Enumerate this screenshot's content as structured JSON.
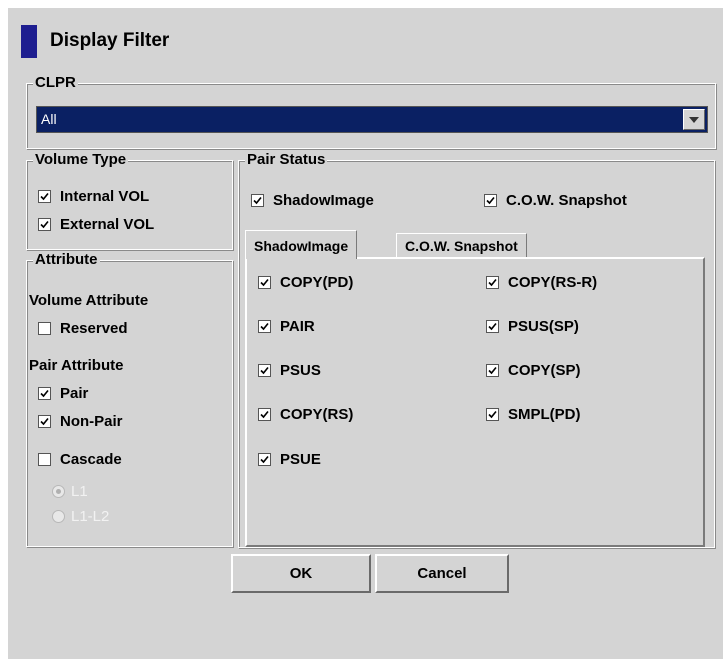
{
  "dialog": {
    "title": "Display Filter"
  },
  "clpr": {
    "legend": "CLPR",
    "selected": "All"
  },
  "volume_type": {
    "legend": "Volume Type",
    "items": [
      {
        "label": "Internal VOL",
        "checked": true
      },
      {
        "label": "External VOL",
        "checked": true
      }
    ]
  },
  "attribute": {
    "legend": "Attribute",
    "volume_attribute_label": "Volume Attribute",
    "reserved": {
      "label": "Reserved",
      "checked": false
    },
    "pair_attribute_label": "Pair Attribute",
    "pair": {
      "label": "Pair",
      "checked": true
    },
    "non_pair": {
      "label": "Non-Pair",
      "checked": true
    },
    "cascade": {
      "label": "Cascade",
      "checked": false
    },
    "levels": [
      {
        "label": "L1",
        "selected": true,
        "enabled": false
      },
      {
        "label": "L1-L2",
        "selected": false,
        "enabled": false
      }
    ]
  },
  "pair_status": {
    "legend": "Pair Status",
    "shadowimage": {
      "label": "ShadowImage",
      "checked": true
    },
    "cow": {
      "label": "C.O.W. Snapshot",
      "checked": true
    },
    "tabs": [
      {
        "label": "ShadowImage",
        "active": true
      },
      {
        "label": "C.O.W. Snapshot",
        "active": false
      }
    ],
    "status_left": [
      {
        "label": "COPY(PD)",
        "checked": true
      },
      {
        "label": "PAIR",
        "checked": true
      },
      {
        "label": "PSUS",
        "checked": true
      },
      {
        "label": "COPY(RS)",
        "checked": true
      },
      {
        "label": "PSUE",
        "checked": true
      }
    ],
    "status_right": [
      {
        "label": "COPY(RS-R)",
        "checked": true
      },
      {
        "label": "PSUS(SP)",
        "checked": true
      },
      {
        "label": "COPY(SP)",
        "checked": true
      },
      {
        "label": "SMPL(PD)",
        "checked": true
      }
    ]
  },
  "buttons": {
    "ok": "OK",
    "cancel": "Cancel"
  }
}
